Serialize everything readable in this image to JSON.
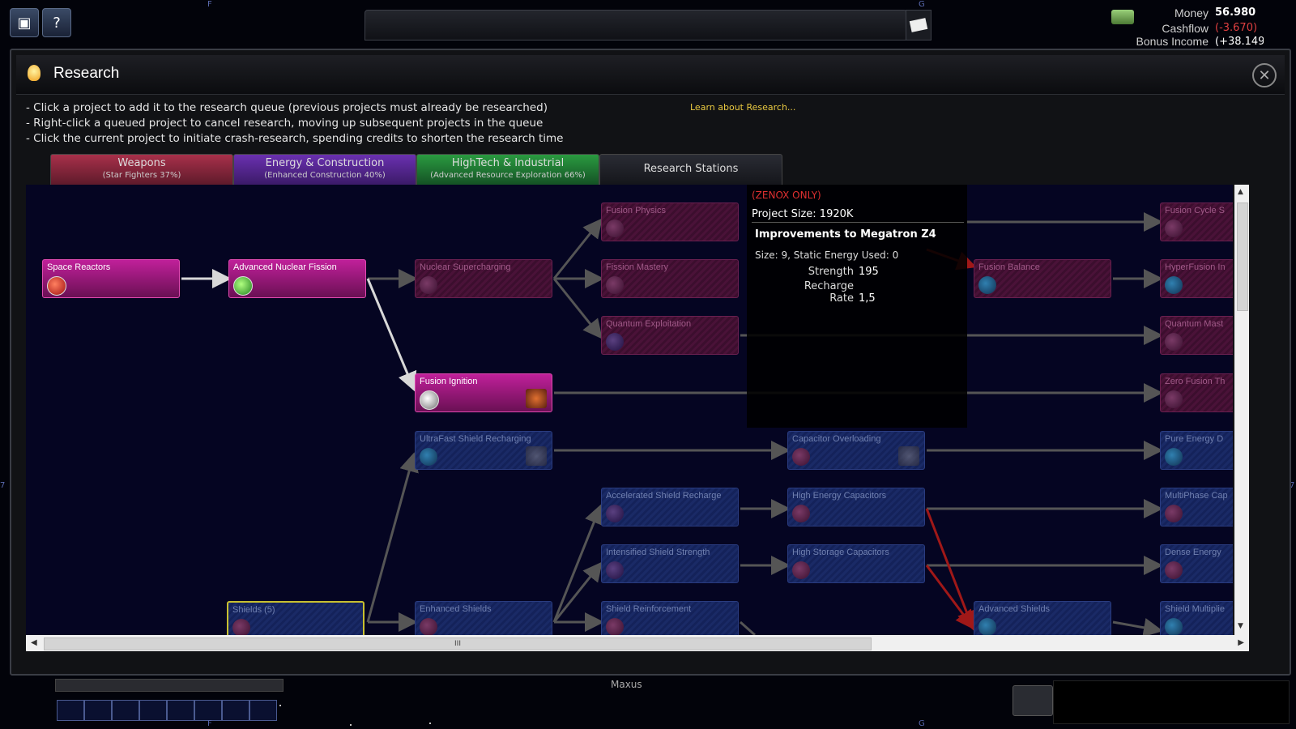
{
  "hud": {
    "money_label": "Money",
    "money_value": "56.980",
    "cashflow_label": "Cashflow",
    "cashflow_value": "(-3.670)",
    "bonus_label": "Bonus Income",
    "bonus_value": "(+38.149)",
    "map_markers": {
      "f_top": "F",
      "g_top": "G",
      "f_bottom": "F",
      "g_bottom": "G",
      "side_7_left": "7",
      "side_7_right": "7"
    },
    "system_name": "Maxus"
  },
  "window": {
    "title": "Research",
    "close_icon": "close-icon",
    "instructions": [
      "- Click a project to add it to the research queue (previous projects must already be researched)",
      "- Right-click a queued project to cancel research, moving up subsequent projects in the queue",
      "- Click the current project to initiate crash-research, spending credits to shorten the research time"
    ],
    "learn_link": "Learn about Research..."
  },
  "tabs": [
    {
      "label": "Weapons",
      "sub": "(Star Fighters 37%)",
      "color": "#a8304a"
    },
    {
      "label": "Energy & Construction",
      "sub": "(Enhanced Construction 40%)",
      "color": "#6a30b0"
    },
    {
      "label": "HighTech & Industrial",
      "sub": "(Advanced Resource Exploration 66%)",
      "color": "#2a9a40"
    },
    {
      "label": "Research Stations",
      "sub": "",
      "color": "#2a2c34"
    }
  ],
  "nodes": {
    "space_reactors": "Space Reactors",
    "advanced_nuclear_fission": "Advanced Nuclear Fission",
    "nuclear_supercharging": "Nuclear Supercharging",
    "fusion_ignition": "Fusion Ignition",
    "ultrafast_shield_recharging": "UltraFast Shield Recharging",
    "shields": "Shields (5)",
    "enhanced_shields": "Enhanced Shields",
    "fusion_physics": "Fusion Physics",
    "fission_mastery": "Fission Mastery",
    "quantum_exploitation": "Quantum Exploitation",
    "accelerated_shield_recharge": "Accelerated Shield Recharge",
    "intensified_shield_strength": "Intensified Shield Strength",
    "shield_reinforcement": "Shield Reinforcement",
    "capacitor_overloading": "Capacitor Overloading",
    "high_energy_capacitors": "High Energy Capacitors",
    "high_storage_capacitors": "High Storage Capacitors",
    "fusion_balance": "Fusion Balance",
    "advanced_shields": "Advanced Shields",
    "fusion_cycle": "Fusion Cycle S",
    "hyperfusion": "HyperFusion In",
    "quantum_mast": "Quantum Mast",
    "zero_fusion": "Zero Fusion Th",
    "pure_energy": "Pure Energy D",
    "multiphase": "MultiPhase Cap",
    "dense_energy": "Dense Energy",
    "shield_multiplier": "Shield Multiplie"
  },
  "tooltip": {
    "restriction": "(ZENOX ONLY)",
    "project_size": "Project Size: 1920K",
    "title": "Improvements to Megatron Z4",
    "stats_line": "Size: 9,  Static Energy Used: 0",
    "strength_label": "Strength",
    "strength_value": "195",
    "recharge_label": "Recharge Rate",
    "recharge_value": "1,5"
  },
  "scroll": {
    "h_thumb": "III"
  },
  "colors": {
    "accent_pink": "#c0209a",
    "accent_blue": "#1a2a66",
    "negative": "#e04040",
    "link": "#e8c840"
  }
}
